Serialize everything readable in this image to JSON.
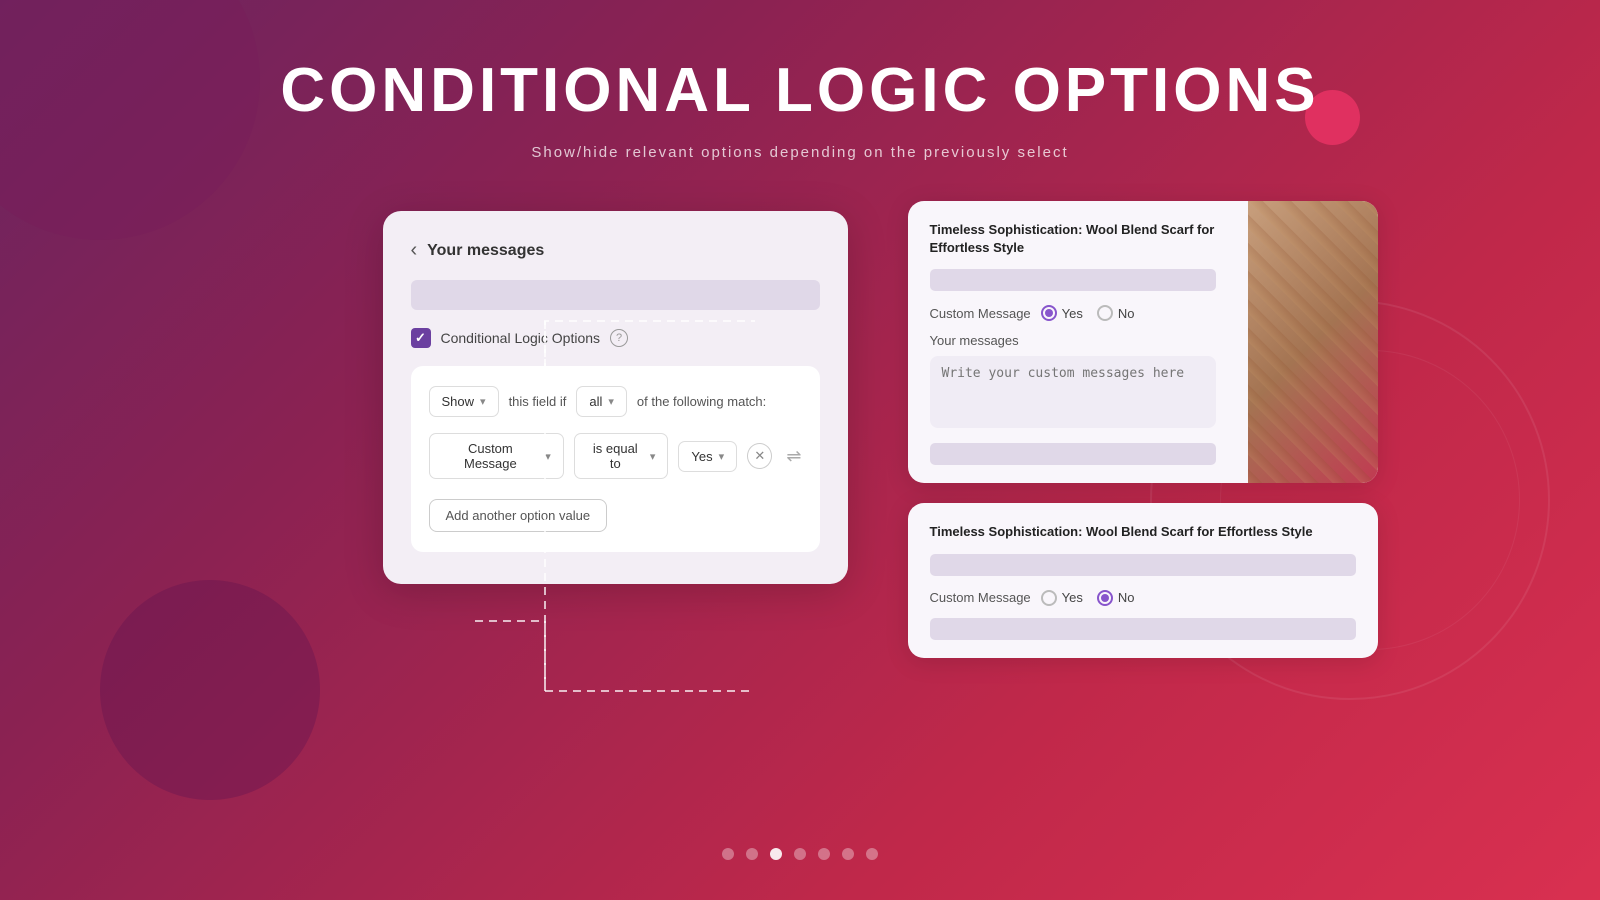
{
  "page": {
    "title": "CONDITIONAL LOGIC OPTIONS",
    "subtitle": "Show/hide relevant options depending on the previously select"
  },
  "left_panel": {
    "back_label": "‹",
    "title": "Your messages",
    "checkbox_label": "Conditional Logic Options",
    "show_label": "Show",
    "this_field_label": "this field if",
    "all_label": "all",
    "following_label": "of the following match:",
    "custom_message_label": "Custom Message",
    "is_equal_label": "is equal to",
    "yes_label": "Yes",
    "add_option_label": "Add another option value"
  },
  "right_top_card": {
    "product_name": "Timeless Sophistication: Wool Blend Scarf for Effortless Style",
    "custom_message_label": "Custom Message",
    "yes_label": "Yes",
    "no_label": "No",
    "yes_selected": true,
    "your_messages_label": "Your messages",
    "textarea_placeholder": "Write your custom messages here"
  },
  "right_bottom_card": {
    "product_name": "Timeless Sophistication: Wool Blend Scarf for Effortless Style",
    "custom_message_label": "Custom Message",
    "yes_label": "Yes",
    "no_label": "No",
    "no_selected": true
  },
  "dots": {
    "total": 7,
    "active_index": 2
  },
  "icons": {
    "back": "‹",
    "chevron_down": "▾",
    "info": "?",
    "close": "✕"
  }
}
